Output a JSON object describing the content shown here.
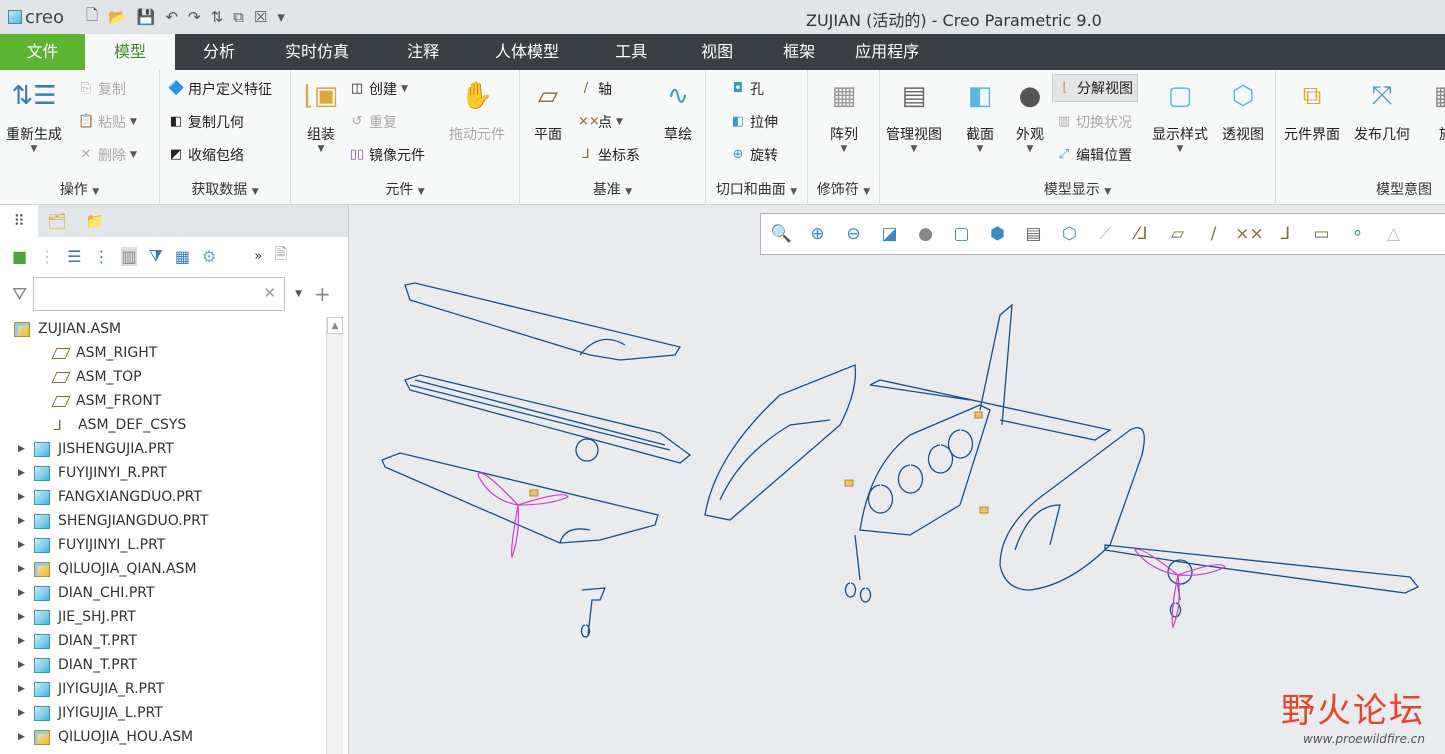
{
  "titlebar": {
    "logo": "creo",
    "title": "ZUJIAN (活动的) - Creo Parametric 9.0"
  },
  "tabs": [
    "文件",
    "模型",
    "分析",
    "实时仿真",
    "注释",
    "人体模型",
    "工具",
    "视图",
    "框架",
    "应用程序"
  ],
  "ribbon": {
    "ops": {
      "label": "操作",
      "regen": "重新生成",
      "copy": "复制",
      "paste": "粘贴",
      "delete": "删除"
    },
    "getdata": {
      "label": "获取数据",
      "udf": "用户定义特征",
      "copygeom": "复制几何",
      "shrink": "收缩包络"
    },
    "comp": {
      "label": "元件",
      "assemble": "组装",
      "create": "创建",
      "repeat": "重复",
      "mirror": "镜像元件",
      "drag": "拖动元件"
    },
    "datum": {
      "label": "基准",
      "plane": "平面",
      "axis": "轴",
      "point": "点",
      "csys": "坐标系",
      "sketch": "草绘"
    },
    "cut": {
      "label": "切口和曲面",
      "hole": "孔",
      "extrude": "拉伸",
      "revolve": "旋转"
    },
    "mod": {
      "label": "修饰符",
      "pattern": "阵列"
    },
    "display": {
      "label": "模型显示",
      "manage": "管理视图",
      "section": "截面",
      "appearance": "外观",
      "explode": "分解视图",
      "toggle": "切换状况",
      "editpos": "编辑位置",
      "style": "显示样式",
      "persp": "透视图"
    },
    "intent": {
      "label": "模型意图",
      "interface": "元件界面",
      "publish": "发布几何",
      "family": "族"
    }
  },
  "tree": [
    {
      "name": "ZUJIAN.ASM",
      "type": "asm",
      "root": true
    },
    {
      "name": "ASM_RIGHT",
      "type": "plane"
    },
    {
      "name": "ASM_TOP",
      "type": "plane"
    },
    {
      "name": "ASM_FRONT",
      "type": "plane"
    },
    {
      "name": "ASM_DEF_CSYS",
      "type": "csys"
    },
    {
      "name": "JISHENGUJIA.PRT",
      "type": "prt"
    },
    {
      "name": "FUYIJINYI_R.PRT",
      "type": "prt"
    },
    {
      "name": "FANGXIANGDUO.PRT",
      "type": "prt"
    },
    {
      "name": "SHENGJIANGDUO.PRT",
      "type": "prt"
    },
    {
      "name": "FUYIJINYI_L.PRT",
      "type": "prt"
    },
    {
      "name": "QILUOJIA_QIAN.ASM",
      "type": "asm"
    },
    {
      "name": "DIAN_CHI.PRT",
      "type": "prt"
    },
    {
      "name": "JIE_SHJ.PRT",
      "type": "prt"
    },
    {
      "name": "DIAN_T.PRT",
      "type": "prt"
    },
    {
      "name": "DIAN_T.PRT",
      "type": "prt"
    },
    {
      "name": "JIYIGUJIA_R.PRT",
      "type": "prt"
    },
    {
      "name": "JIYIGUJIA_L.PRT",
      "type": "prt"
    },
    {
      "name": "QILUOJIA_HOU.ASM",
      "type": "asm"
    }
  ],
  "watermark": {
    "text": "野火论坛",
    "url": "www.proewildfire.cn"
  },
  "colors": {
    "accent": "#5cb531",
    "tabbar": "#393f42",
    "wire": "#1a4f86",
    "prop": "#d33ccc"
  }
}
